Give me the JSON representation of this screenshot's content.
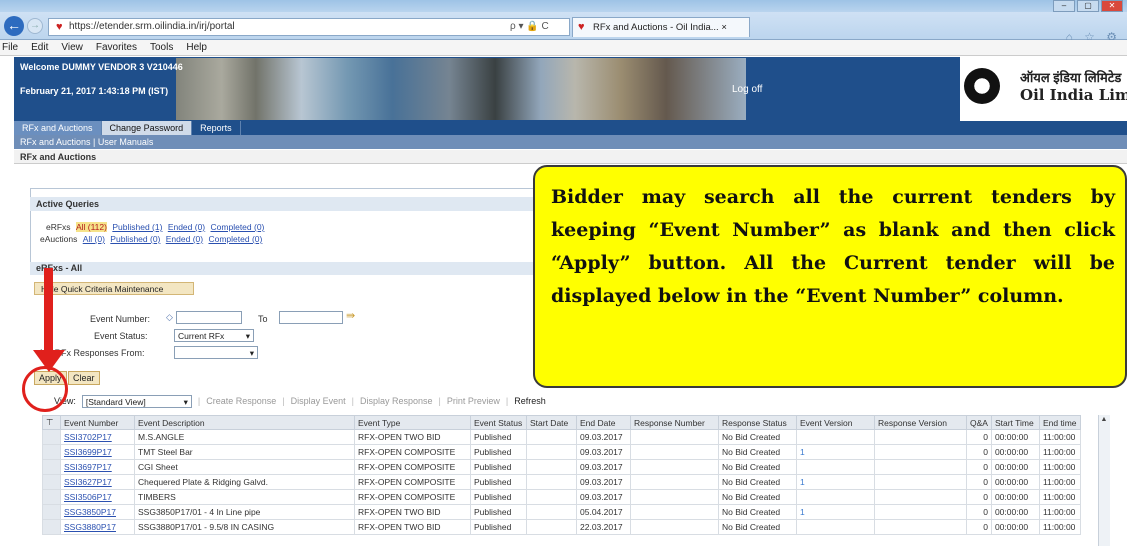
{
  "browser": {
    "url": "https://etender.srm.oilindia.in/irj/portal",
    "tab_title": "RFx and Auctions - Oil India...",
    "tab_close": "×",
    "back_glyph": "←",
    "forward_glyph": "→",
    "address_icons": "ρ ▾ 🔒 C",
    "chrome_right": "⌂ ☆ ⚙",
    "window_buttons": [
      "–",
      "▢",
      "✕"
    ],
    "menu": [
      "File",
      "Edit",
      "View",
      "Favorites",
      "Tools",
      "Help"
    ]
  },
  "portal": {
    "welcome": "Welcome DUMMY VENDOR 3 V210446",
    "datetime": "February 21, 2017  1:43:18 PM (IST)",
    "logoff": "Log off",
    "logo_hindi": "ऑयल इंडिया लिमिटेड",
    "logo_en": "Oil India Limited",
    "tabs": [
      "RFx and Auctions",
      "Change Password",
      "Reports"
    ],
    "subnav": "RFx and Auctions  |  User Manuals",
    "page_title": "RFx and Auctions"
  },
  "queries": {
    "header": "Active Queries",
    "erfx_label": "eRFxs",
    "erfx_links": [
      "All (112)",
      "Published (1)",
      "Ended (0)",
      "Completed (0)"
    ],
    "eauction_label": "eAuctions",
    "eauction_links": [
      "All (0)",
      "Published (0)",
      "Ended (0)",
      "Completed (0)"
    ]
  },
  "criteria": {
    "section_title": "eRFxs - All",
    "maintenance_button": "Hide Quick Criteria Maintenance",
    "event_number_label": "Event Number:",
    "to_label": "To",
    "event_status_label": "Event Status:",
    "event_status_value": "Current RFx",
    "responses_from_label": "My RFx Responses From:",
    "apply": "Apply",
    "clear": "Clear"
  },
  "toolbar": {
    "view_label": "View:",
    "view_value": "[Standard View]",
    "create": "Create Response",
    "display_event": "Display Event",
    "display_response": "Display Response",
    "print": "Print Preview",
    "refresh": "Refresh"
  },
  "table": {
    "columns": [
      "Event Number",
      "Event Description",
      "Event Type",
      "Event Status",
      "Start Date",
      "End Date",
      "Response Number",
      "Response Status",
      "Event Version",
      "Response Version",
      "Q&A",
      "Start Time",
      "End time"
    ],
    "rows": [
      [
        "SSI3702P17",
        "M.S.ANGLE",
        "RFX-OPEN TWO BID",
        "Published",
        "",
        "09.03.2017",
        "",
        "No Bid Created",
        "",
        "",
        "0",
        "00:00:00",
        "11:00:00"
      ],
      [
        "SSI3699P17",
        "TMT Steel Bar",
        "RFX-OPEN COMPOSITE",
        "Published",
        "",
        "09.03.2017",
        "",
        "No Bid Created",
        "1",
        "",
        "0",
        "00:00:00",
        "11:00:00"
      ],
      [
        "SSI3697P17",
        "CGI Sheet",
        "RFX-OPEN COMPOSITE",
        "Published",
        "",
        "09.03.2017",
        "",
        "No Bid Created",
        "",
        "",
        "0",
        "00:00:00",
        "11:00:00"
      ],
      [
        "SSI3627P17",
        "Chequered Plate & Ridging Galvd.",
        "RFX-OPEN COMPOSITE",
        "Published",
        "",
        "09.03.2017",
        "",
        "No Bid Created",
        "1",
        "",
        "0",
        "00:00:00",
        "11:00:00"
      ],
      [
        "SSI3506P17",
        "TIMBERS",
        "RFX-OPEN COMPOSITE",
        "Published",
        "",
        "09.03.2017",
        "",
        "No Bid Created",
        "",
        "",
        "0",
        "00:00:00",
        "11:00:00"
      ],
      [
        "SSG3850P17",
        "SSG3850P17/01 - 4 In Line pipe",
        "RFX-OPEN TWO BID",
        "Published",
        "",
        "05.04.2017",
        "",
        "No Bid Created",
        "1",
        "",
        "0",
        "00:00:00",
        "11:00:00"
      ],
      [
        "SSG3880P17",
        "SSG3880P17/01 - 9.5/8 IN CASING",
        "RFX-OPEN TWO BID",
        "Published",
        "",
        "22.03.2017",
        "",
        "No Bid Created",
        "",
        "",
        "0",
        "00:00:00",
        "11:00:00"
      ]
    ]
  },
  "callout": "Bidder may search all the current tenders by keeping  “Event Number” as blank and then click “Apply” button. All the Current tender will be displayed below in the “Event Number” column."
}
